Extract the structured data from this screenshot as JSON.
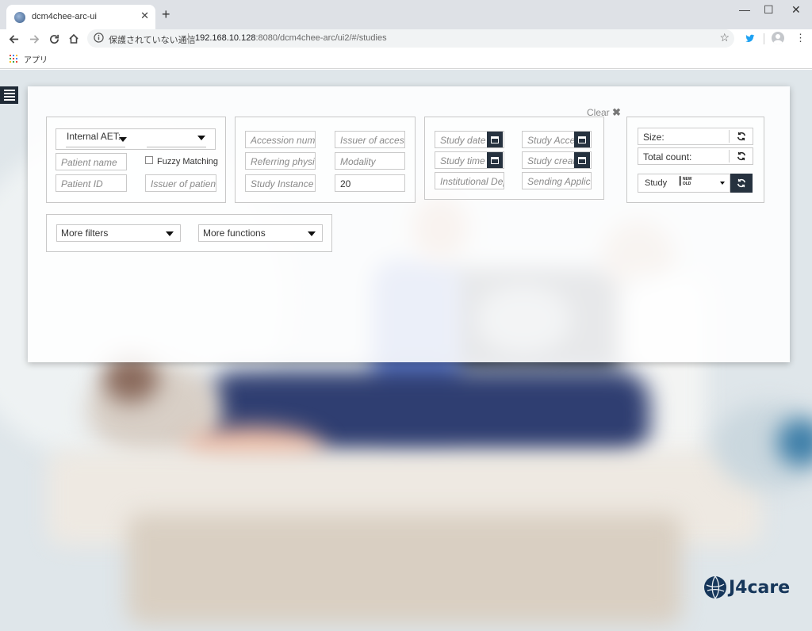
{
  "browser": {
    "tab_title": "dcm4chee-arc-ui",
    "new_tab_symbol": "+",
    "window_controls": {
      "minimize": "—",
      "maximize": "☐",
      "close": "✕"
    },
    "address": {
      "security_text": "保護されていない通信",
      "url_host": "192.168.10.128",
      "url_rest": ":8080/dcm4chee-arc/ui2/#/studies"
    },
    "bookmarks": {
      "apps_label": "アプリ"
    }
  },
  "filters": {
    "clear_label": "Clear",
    "patient": {
      "aet_label": "Internal AET:",
      "aet_value": "",
      "patient_name_placeholder": "Patient name",
      "fuzzy_label": "Fuzzy Matching",
      "fuzzy_checked": false,
      "patient_id_placeholder": "Patient ID",
      "issuer_patient_placeholder": "Issuer of patient"
    },
    "study": {
      "accession_placeholder": "Accession number",
      "issuer_accession_placeholder": "Issuer of accession",
      "referring_placeholder": "Referring physician",
      "modality_placeholder": "Modality",
      "study_instance_placeholder": "Study Instance UID",
      "limit_value": "20"
    },
    "dates": {
      "study_date_placeholder": "Study date",
      "study_access_placeholder": "Study Access",
      "study_time_placeholder": "Study time",
      "study_created_placeholder": "Study created",
      "institutional_placeholder": "Institutional Department",
      "sending_placeholder": "Sending Application"
    },
    "count": {
      "size_label": "Size:",
      "total_count_label": "Total count:",
      "order_value": "Study",
      "order_badge_top": "NEW",
      "order_badge_bottom": "OLD"
    },
    "more": {
      "more_filters_label": "More filters",
      "more_functions_label": "More functions"
    }
  },
  "logo": {
    "text": "J4care"
  },
  "colors": {
    "accent_dark": "#26323f",
    "logo_blue": "#16365a",
    "twitter": "#1da1f2"
  }
}
